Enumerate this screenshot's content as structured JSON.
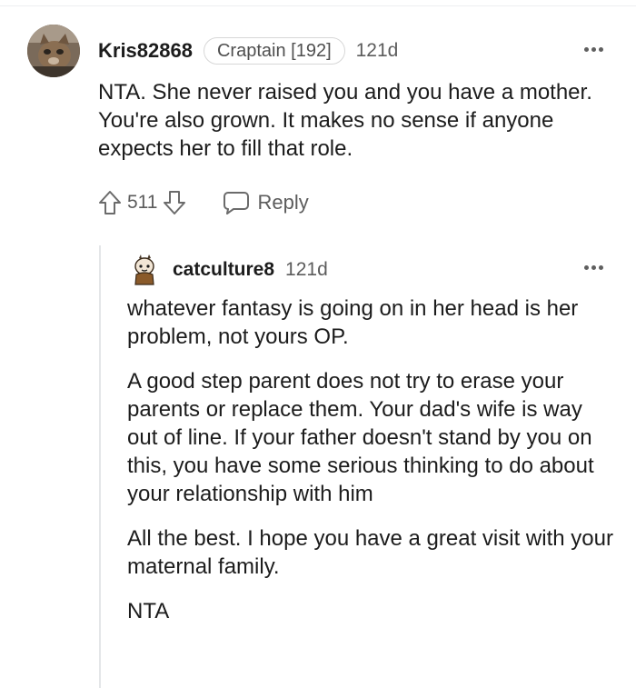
{
  "comment": {
    "username": "Kris82868",
    "flair": "Craptain [192]",
    "age": "121d",
    "body": "NTA. She never raised you and you have a mother. You're also grown. It makes no sense if anyone expects her to fill that role.",
    "score": "511",
    "reply_label": "Reply"
  },
  "reply": {
    "username": "catculture8",
    "age": "121d",
    "paragraphs": [
      "whatever fantasy is going on in her head is her problem, not yours OP.",
      "A good step parent does not try to erase your parents or replace them. Your dad's wife is way out of line. If your father doesn't stand by you on this, you have some serious thinking to do about your relationship with him",
      "All the best. I hope you have a great visit with your maternal family.",
      "NTA"
    ]
  },
  "icons": {
    "more": "more-options-icon",
    "upvote": "upvote-arrow-icon",
    "downvote": "downvote-arrow-icon",
    "reply": "speech-bubble-icon"
  },
  "colors": {
    "text": "#1c1c1c",
    "meta": "#5c5c5c",
    "thread_line": "#e4e6e8"
  }
}
